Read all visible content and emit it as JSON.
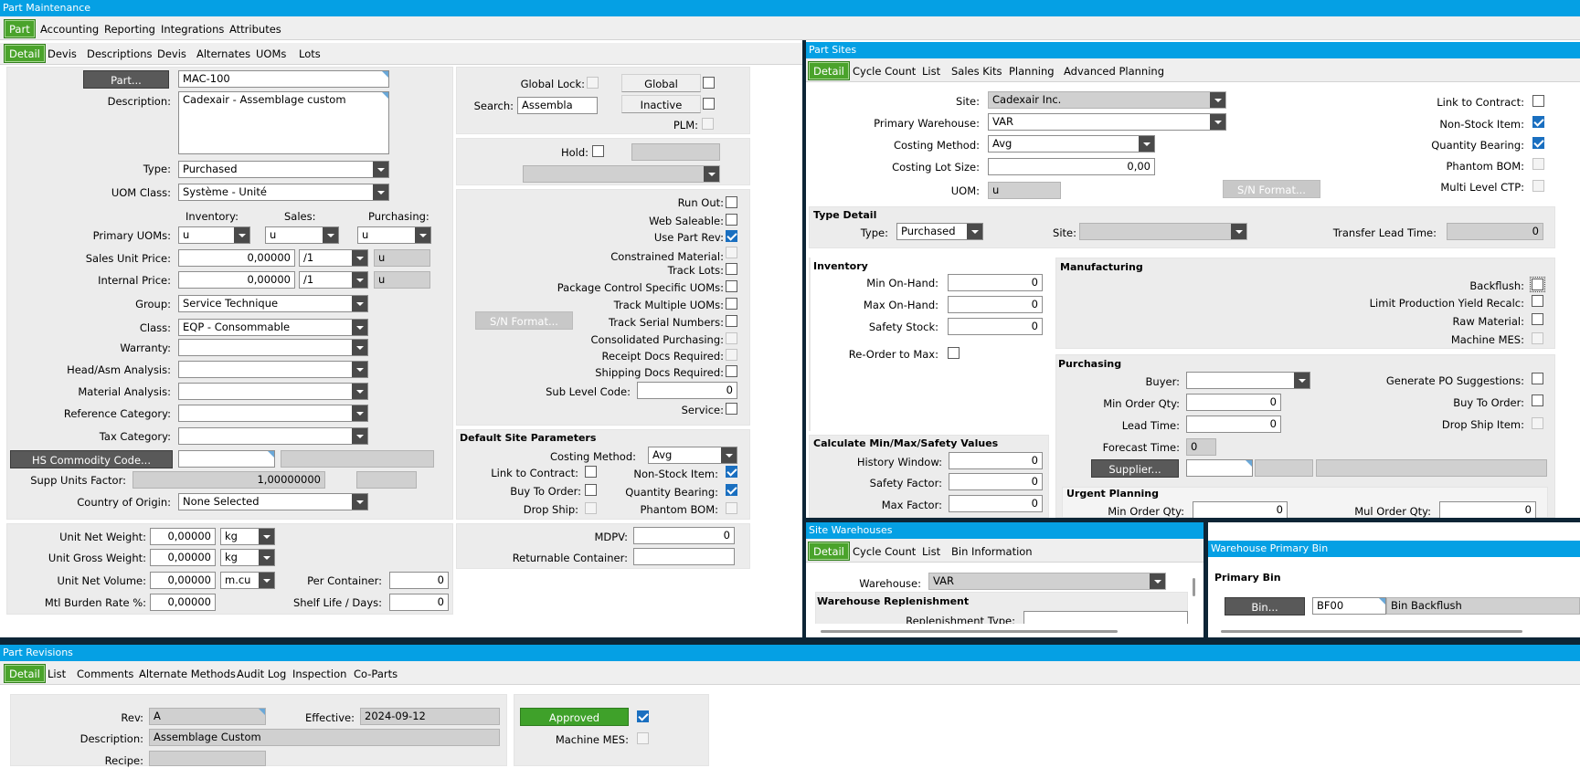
{
  "part_maintenance": {
    "title": "Part Maintenance",
    "top_tabs": [
      "Part",
      "Accounting",
      "Reporting",
      "Integrations",
      "Attributes"
    ],
    "sub_tabs": [
      "Detail",
      "Devis",
      "Descriptions",
      "Devis",
      "Alternates",
      "UOMs",
      "Lots"
    ],
    "part_button": "Part...",
    "part_value": "MAC-100",
    "description_label": "Description:",
    "description_value": "Cadexair - Assemblage custom",
    "type_label": "Type:",
    "type_value": "Purchased",
    "uom_class_label": "UOM Class:",
    "uom_class_value": "Système - Unité",
    "col_inventory": "Inventory:",
    "col_sales": "Sales:",
    "col_purchasing": "Purchasing:",
    "primary_uoms_label": "Primary UOMs:",
    "inv_uom": "u",
    "sales_uom": "u",
    "purch_uom": "u",
    "sales_price_label": "Sales Unit Price:",
    "sales_price": "0,00000",
    "sales_per": "/1",
    "sales_price_uom": "u",
    "internal_price_label": "Internal Price:",
    "internal_price": "0,00000",
    "internal_per": "/1",
    "internal_price_uom": "u",
    "group_label": "Group:",
    "group_value": "Service Technique",
    "class_label": "Class:",
    "class_value": "EQP - Consommable",
    "warranty_label": "Warranty:",
    "head_asm_label": "Head/Asm Analysis:",
    "material_label": "Material Analysis:",
    "ref_cat_label": "Reference Category:",
    "tax_cat_label": "Tax Category:",
    "hs_button": "HS Commodity Code...",
    "supp_units_label": "Supp Units Factor:",
    "supp_units_value": "1,00000000",
    "country_label": "Country of Origin:",
    "country_value": "None Selected",
    "global_lock_label": "Global Lock:",
    "global_button": "Global",
    "inactive_button": "Inactive",
    "search_label": "Search:",
    "search_value": "Assembla",
    "plm_label": "PLM:",
    "hold_label": "Hold:",
    "sn_format": "S/N Format...",
    "flags": {
      "run_out": "Run Out:",
      "web_saleable": "Web Saleable:",
      "use_part_rev": "Use Part Rev:",
      "constrained": "Constrained Material:",
      "track_lots": "Track Lots:",
      "pkg_control": "Package Control Specific UOMs:",
      "track_multi": "Track Multiple UOMs:",
      "track_serial": "Track Serial Numbers:",
      "consolidated": "Consolidated Purchasing:",
      "receipt_docs": "Receipt Docs Required:",
      "shipping_docs": "Shipping Docs Required:",
      "sub_level": "Sub Level Code:",
      "service": "Service:"
    },
    "sub_level_value": "0",
    "default_site": {
      "title": "Default Site Parameters",
      "costing_label": "Costing Method:",
      "costing_value": "Avg",
      "link_contract": "Link to Contract:",
      "non_stock": "Non-Stock Item:",
      "buy_to_order": "Buy To Order:",
      "qty_bearing": "Quantity Bearing:",
      "drop_ship": "Drop Ship:",
      "phantom": "Phantom BOM:"
    },
    "weights": {
      "net_weight_label": "Unit Net Weight:",
      "net_weight": "0,00000",
      "net_weight_uom": "kg",
      "gross_weight_label": "Unit Gross Weight:",
      "gross_weight": "0,00000",
      "gross_weight_uom": "kg",
      "net_volume_label": "Unit Net Volume:",
      "net_volume": "0,00000",
      "net_volume_uom": "m.cu",
      "burden_label": "Mtl Burden Rate %:",
      "burden": "0,00000",
      "per_container_label": "Per Container:",
      "per_container": "0",
      "shelf_life_label": "Shelf Life / Days:",
      "shelf_life": "0"
    },
    "mdpv_label": "MDPV:",
    "mdpv_value": "0",
    "returnable_label": "Returnable Container:"
  },
  "part_sites": {
    "title": "Part Sites",
    "tabs": [
      "Detail",
      "Cycle Count",
      "List",
      "Sales Kits",
      "Planning",
      "Advanced Planning"
    ],
    "site_label": "Site:",
    "site_value": "Cadexair Inc.",
    "primary_wh_label": "Primary Warehouse:",
    "primary_wh_value": "VAR",
    "costing_label": "Costing Method:",
    "costing_value": "Avg",
    "lot_size_label": "Costing Lot Size:",
    "lot_size_value": "0,00",
    "uom_label": "UOM:",
    "uom_value": "u",
    "sn_format": "S/N Format...",
    "link_contract": "Link to Contract:",
    "non_stock": "Non-Stock Item:",
    "qty_bearing": "Quantity Bearing:",
    "phantom": "Phantom BOM:",
    "multi_ctp": "Multi Level CTP:",
    "type_detail": {
      "title": "Type Detail",
      "type_label": "Type:",
      "type_value": "Purchased",
      "site_label": "Site:",
      "transfer_label": "Transfer Lead Time:",
      "transfer_value": "0"
    },
    "inventory": {
      "title": "Inventory",
      "min_label": "Min On-Hand:",
      "min_value": "0",
      "max_label": "Max On-Hand:",
      "max_value": "0",
      "safety_label": "Safety Stock:",
      "safety_value": "0",
      "reorder_label": "Re-Order to Max:"
    },
    "calc": {
      "title": "Calculate Min/Max/Safety Values",
      "history_label": "History Window:",
      "history_value": "0",
      "safety_factor_label": "Safety Factor:",
      "safety_factor_value": "0",
      "max_factor_label": "Max Factor:",
      "max_factor_value": "0"
    },
    "manufacturing": {
      "title": "Manufacturing",
      "backflush": "Backflush:",
      "limit_yield": "Limit Production Yield Recalc:",
      "raw_material": "Raw Material:",
      "machine_mes": "Machine MES:"
    },
    "purchasing": {
      "title": "Purchasing",
      "buyer_label": "Buyer:",
      "generate_po": "Generate PO Suggestions:",
      "min_order_label": "Min Order Qty:",
      "min_order_value": "0",
      "buy_to_order": "Buy To Order:",
      "lead_time_label": "Lead Time:",
      "lead_time_value": "0",
      "drop_ship": "Drop Ship Item:",
      "forecast_label": "Forecast Time:",
      "forecast_value": "0",
      "supplier_button": "Supplier..."
    },
    "urgent": {
      "title": "Urgent Planning",
      "min_order_label": "Min Order Qty:",
      "min_order_value": "0",
      "mul_order_label": "Mul Order Qty:",
      "mul_order_value": "0"
    }
  },
  "site_warehouses": {
    "title": "Site Warehouses",
    "tabs": [
      "Detail",
      "Cycle Count",
      "List",
      "Bin Information"
    ],
    "warehouse_label": "Warehouse:",
    "warehouse_value": "VAR",
    "replenishment_title": "Warehouse Replenishment",
    "replenishment_type_label": "Replenishment Type:"
  },
  "primary_bin": {
    "title": "Warehouse Primary Bin",
    "group": "Primary Bin",
    "bin_button": "Bin...",
    "bin_code": "BF00",
    "bin_desc": "Bin Backflush"
  },
  "part_revisions": {
    "title": "Part Revisions",
    "tabs": [
      "Detail",
      "List",
      "Comments",
      "Alternate Methods",
      "Audit Log",
      "Inspection",
      "Co-Parts"
    ],
    "rev_label": "Rev:",
    "rev_value": "A",
    "effective_label": "Effective:",
    "effective_value": "2024-09-12",
    "description_label": "Description:",
    "description_value": "Assemblage Custom",
    "recipe_label": "Recipe:",
    "approved_button": "Approved",
    "machine_mes": "Machine MES:"
  }
}
